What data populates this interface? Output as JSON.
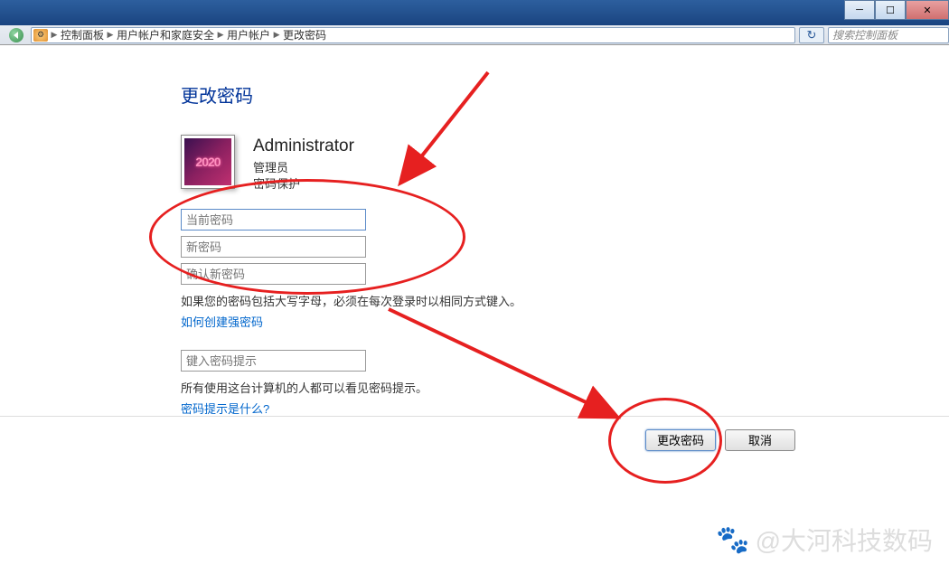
{
  "breadcrumb": {
    "items": [
      "控制面板",
      "用户帐户和家庭安全",
      "用户帐户",
      "更改密码"
    ]
  },
  "search": {
    "placeholder": "搜索控制面板"
  },
  "page": {
    "title": "更改密码"
  },
  "user": {
    "avatar_text": "2020",
    "name": "Administrator",
    "role": "管理员",
    "status": "密码保护"
  },
  "form": {
    "current_password_placeholder": "当前密码",
    "new_password_placeholder": "新密码",
    "confirm_password_placeholder": "确认新密码",
    "caps_hint": "如果您的密码包括大写字母，必须在每次登录时以相同方式键入。",
    "strong_link": "如何创建强密码",
    "hint_placeholder": "键入密码提示",
    "hint_help": "所有使用这台计算机的人都可以看见密码提示。",
    "hint_link": "密码提示是什么?"
  },
  "buttons": {
    "submit": "更改密码",
    "cancel": "取消"
  },
  "watermark": {
    "text": "@大河科技数码"
  }
}
